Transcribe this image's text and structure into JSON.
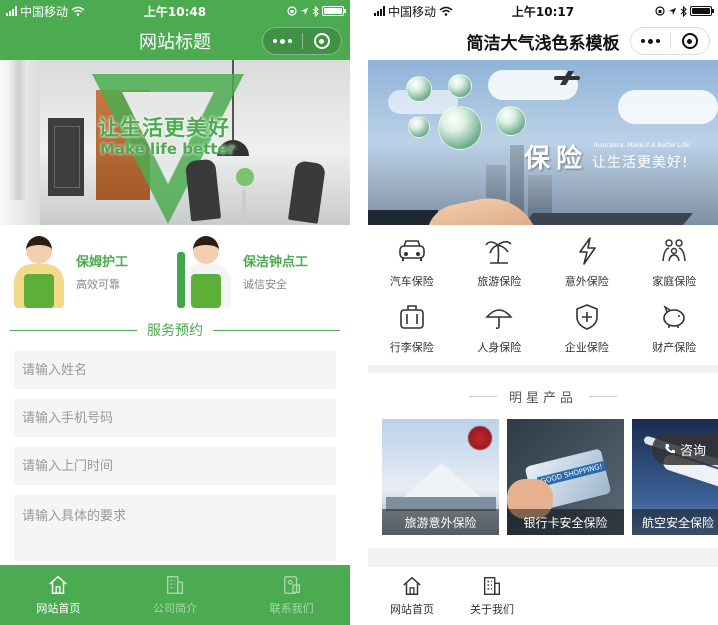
{
  "left": {
    "status": {
      "carrier": "中国移动",
      "time": "上午10:48"
    },
    "title": "网站标题",
    "banner": {
      "slogan_cn": "让生活更美好",
      "slogan_en": "Make life better"
    },
    "services": [
      {
        "title": "保姆护工",
        "sub": "高效可靠"
      },
      {
        "title": "保洁钟点工",
        "sub": "诚信安全"
      }
    ],
    "section_title": "服务预约",
    "form": {
      "name_placeholder": "请输入姓名",
      "phone_placeholder": "请输入手机号码",
      "time_placeholder": "请输入上门时间",
      "request_placeholder": "请输入具体的要求"
    },
    "tabs": [
      {
        "label": "网站首页",
        "icon": "home-icon",
        "active": true
      },
      {
        "label": "公司简介",
        "icon": "building-icon",
        "active": false
      },
      {
        "label": "联系我们",
        "icon": "contact-icon",
        "active": false
      }
    ],
    "colors": {
      "primary": "#4cab50"
    }
  },
  "right": {
    "status": {
      "carrier": "中国移动",
      "time": "上午10:17"
    },
    "title": "简洁大气浅色系模板",
    "banner": {
      "title_cn": "保险",
      "tagline_en": "Insurance, Make It A Better Life!",
      "tagline_cn": "让生活更美好!"
    },
    "categories": [
      {
        "label": "汽车保险",
        "icon": "car-icon"
      },
      {
        "label": "旅游保险",
        "icon": "palm-tree-icon"
      },
      {
        "label": "意外保险",
        "icon": "lightning-icon"
      },
      {
        "label": "家庭保险",
        "icon": "family-icon"
      },
      {
        "label": "行李保险",
        "icon": "luggage-icon"
      },
      {
        "label": "人身保险",
        "icon": "umbrella-icon"
      },
      {
        "label": "企业保险",
        "icon": "shield-icon"
      },
      {
        "label": "财产保险",
        "icon": "piggy-bank-icon"
      }
    ],
    "star_title": "明星产品",
    "products": [
      {
        "label": "旅游意外保险"
      },
      {
        "label": "银行卡安全保险",
        "tag": "GOOD SHOPPING!"
      },
      {
        "label": "航空安全保险"
      }
    ],
    "consult": "咨询",
    "tabs": [
      {
        "label": "网站首页",
        "icon": "home-icon"
      },
      {
        "label": "关于我们",
        "icon": "building-icon"
      }
    ]
  }
}
